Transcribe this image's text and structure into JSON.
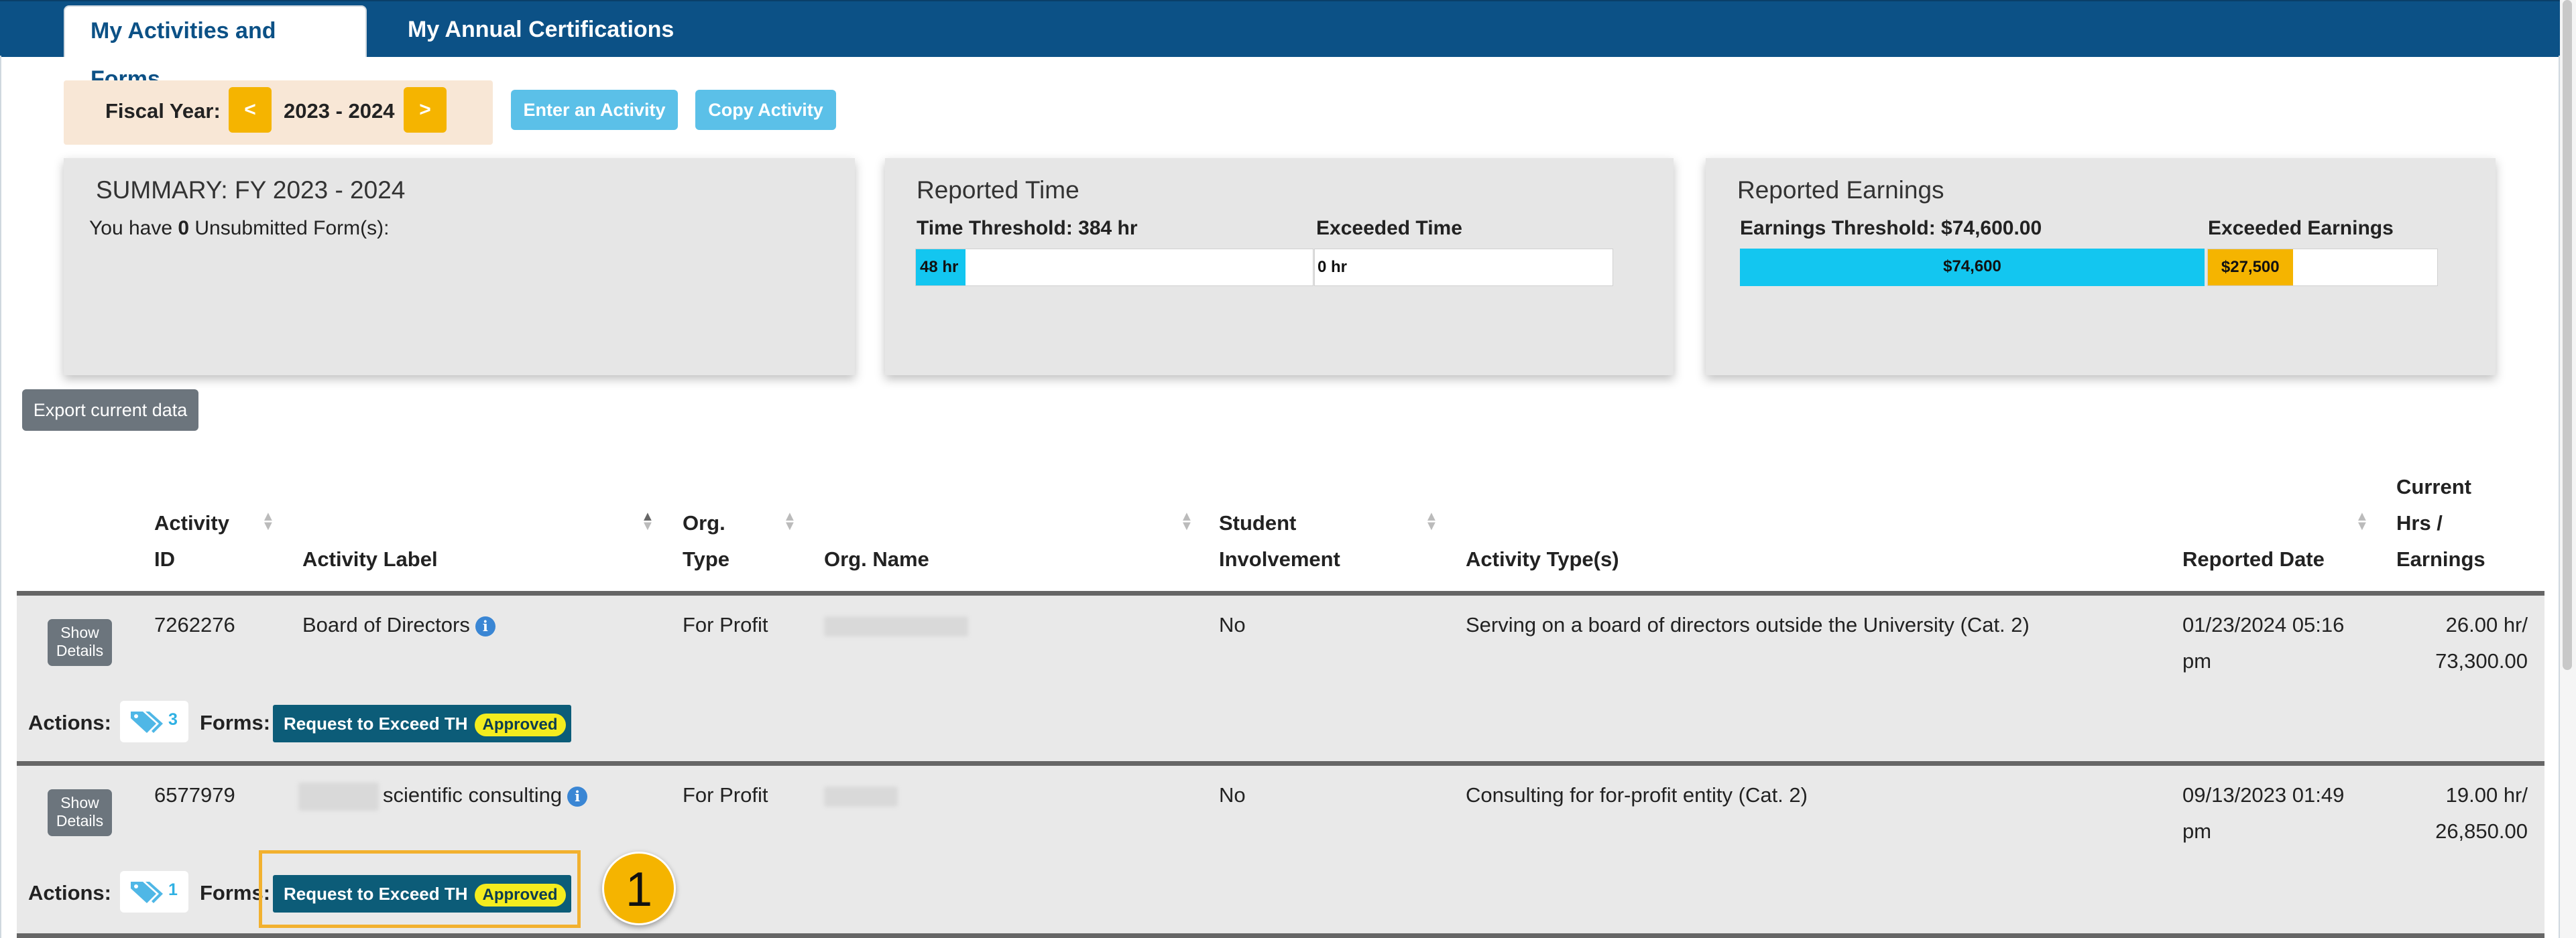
{
  "tabs": [
    {
      "label": "My Activities and Forms",
      "active": true
    },
    {
      "label": "My Annual Certifications",
      "active": false
    }
  ],
  "fiscal_year": {
    "label": "Fiscal Year:",
    "value": "2023 - 2024",
    "prev": "<",
    "next": ">"
  },
  "buttons": {
    "enter_activity": "Enter an Activity",
    "copy_activity": "Copy Activity",
    "export": "Export current data"
  },
  "summary": {
    "title": "SUMMARY: FY 2023 - 2024",
    "text_before": "You have ",
    "count": "0",
    "text_after": " Unsubmitted Form(s):"
  },
  "reported_time": {
    "title": "Reported Time",
    "threshold_label": "Time Threshold: 384 hr",
    "exceeded_label": "Exceeded Time",
    "threshold_value": "48 hr",
    "threshold_fraction": 0.125,
    "exceeded_value": "0 hr"
  },
  "reported_earnings": {
    "title": "Reported Earnings",
    "threshold_label": "Earnings Threshold: $74,600.00",
    "exceeded_label": "Exceeded Earnings",
    "threshold_value": "$74,600",
    "threshold_fraction": 1.0,
    "exceeded_value": "$27,500",
    "exceeded_fraction": 0.37
  },
  "table": {
    "headers": {
      "activity_id_1": "Activity",
      "activity_id_2": "ID",
      "activity_label": "Activity Label",
      "org_type_1": "Org.",
      "org_type_2": "Type",
      "org_name": "Org. Name",
      "student_1": "Student",
      "student_2": "Involvement",
      "activity_types": "Activity Type(s)",
      "reported_date": "Reported Date",
      "current_1": "Current",
      "current_2": "Hrs /",
      "current_3": "Earnings"
    },
    "rows": [
      {
        "show": "Show Details",
        "id": "7262276",
        "label": "Board of Directors",
        "org_type": "For Profit",
        "student": "No",
        "types": "Serving on a board of directors outside the University (Cat. 2)",
        "date_1": "01/23/2024 05:16",
        "date_2": "pm",
        "amount_1": "26.00 hr/",
        "amount_2": "73,300.00",
        "actions_label": "Actions:",
        "tag_count": "3",
        "forms_label": "Forms:",
        "form_name": "Request to Exceed TH",
        "form_status": "Approved"
      },
      {
        "show": "Show Details",
        "id": "6577979",
        "label": "scientific consulting",
        "org_type": "For Profit",
        "student": "No",
        "types": "Consulting for for-profit entity (Cat. 2)",
        "date_1": "09/13/2023 01:49",
        "date_2": "pm",
        "amount_1": "19.00 hr/",
        "amount_2": "26,850.00",
        "actions_label": "Actions:",
        "tag_count": "1",
        "forms_label": "Forms:",
        "form_name": "Request to Exceed TH",
        "form_status": "Approved"
      }
    ]
  },
  "callout": "1",
  "colors": {
    "header_bar": "#0c5186",
    "accent_yellow": "#f5b400",
    "time_fill": "#13c6f0",
    "earnings_exceeded": "#f5b400",
    "form_badge": "#0c5c78"
  }
}
